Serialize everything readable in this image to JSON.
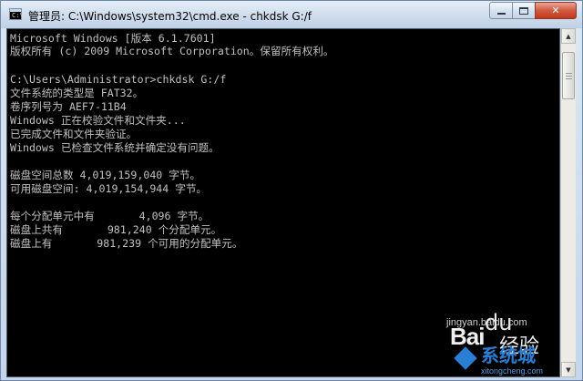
{
  "window": {
    "title": "管理员: C:\\Windows\\system32\\cmd.exe - chkdsk  G:/f",
    "icon": "cmd-icon",
    "icon_glyph": "C:\\",
    "controls": {
      "minimize": "minimize-icon",
      "maximize": "maximize-icon",
      "close_glyph": "✕"
    }
  },
  "console": {
    "lines": [
      "Microsoft Windows [版本 6.1.7601]",
      "版权所有 (c) 2009 Microsoft Corporation。保留所有权利。",
      "",
      "C:\\Users\\Administrator>chkdsk G:/f",
      "文件系统的类型是 FAT32。",
      "卷序列号为 AEF7-11B4",
      "Windows 正在校验文件和文件夹...",
      "已完成文件和文件夹验证。",
      "Windows 已检查文件系统并确定没有问题。",
      "",
      "磁盘空间总数 4,019,159,040 字节。",
      "可用磁盘空间: 4,019,154,944 字节。",
      "",
      "每个分配单元中有       4,096 字节。",
      "磁盘上共有       981,240 个分配单元。",
      "磁盘上有       981,239 个可用的分配单元。"
    ],
    "text_color": "#c0c0c0",
    "background": "#000000"
  },
  "scrollbar": {
    "up_glyph": "▲",
    "down_glyph": "▼"
  },
  "watermark": {
    "url": "jingyan.baidu.com",
    "bai": "Bai",
    "jingyan": "经验",
    "paw": "du",
    "site": "系统城",
    "site_url": "xitongcheng.com",
    "color": "#2a7fd4"
  }
}
